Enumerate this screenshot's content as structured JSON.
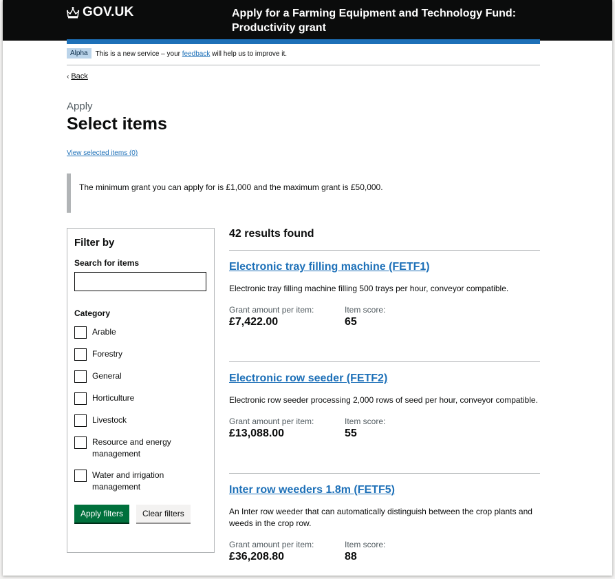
{
  "header": {
    "logo_text": "GOV.UK",
    "service_name": "Apply for a Farming Equipment and Technology Fund: Productivity grant"
  },
  "phase_banner": {
    "tag": "Alpha",
    "text_before": "This is a new service – your ",
    "link": "feedback",
    "text_after": " will help us to improve it."
  },
  "back": "Back",
  "caption": "Apply",
  "title": "Select items",
  "view_selected": "View selected items (0)",
  "inset_text": "The minimum grant you can apply for is £1,000 and the maximum grant is £50,000.",
  "filter": {
    "heading": "Filter by",
    "search_label": "Search for items",
    "search_value": "",
    "category_label": "Category",
    "categories": [
      "Arable",
      "Forestry",
      "General",
      "Horticulture",
      "Livestock",
      "Resource and energy management",
      "Water and irrigation management"
    ],
    "apply_button": "Apply filters",
    "clear_button": "Clear filters"
  },
  "results": {
    "count": "42 results found",
    "items": [
      {
        "title": "Electronic tray filling machine (FETF1)",
        "description": "Electronic tray filling machine filling 500 trays per hour, conveyor compatible.",
        "grant_label": "Grant amount per item:",
        "grant": "£7,422.00",
        "score_label": "Item score:",
        "score": "65"
      },
      {
        "title": "Electronic row seeder (FETF2)",
        "description": "Electronic row seeder processing 2,000 rows of seed per hour, conveyor compatible.",
        "grant_label": "Grant amount per item:",
        "grant": "£13,088.00",
        "score_label": "Item score:",
        "score": "55"
      },
      {
        "title": "Inter row weeders 1.8m (FETF5)",
        "description": "An Inter row weeder that can automatically distinguish between the crop plants and weeds in the crop row.",
        "grant_label": "Grant amount per item:",
        "grant": "£36,208.80",
        "score_label": "Item score:",
        "score": "88"
      }
    ]
  },
  "colors": {
    "header_bg": "#0b0c0c",
    "brand_blue": "#1d70b8",
    "button_green": "#00703c",
    "alpha_tag": "#bbd4ea"
  }
}
